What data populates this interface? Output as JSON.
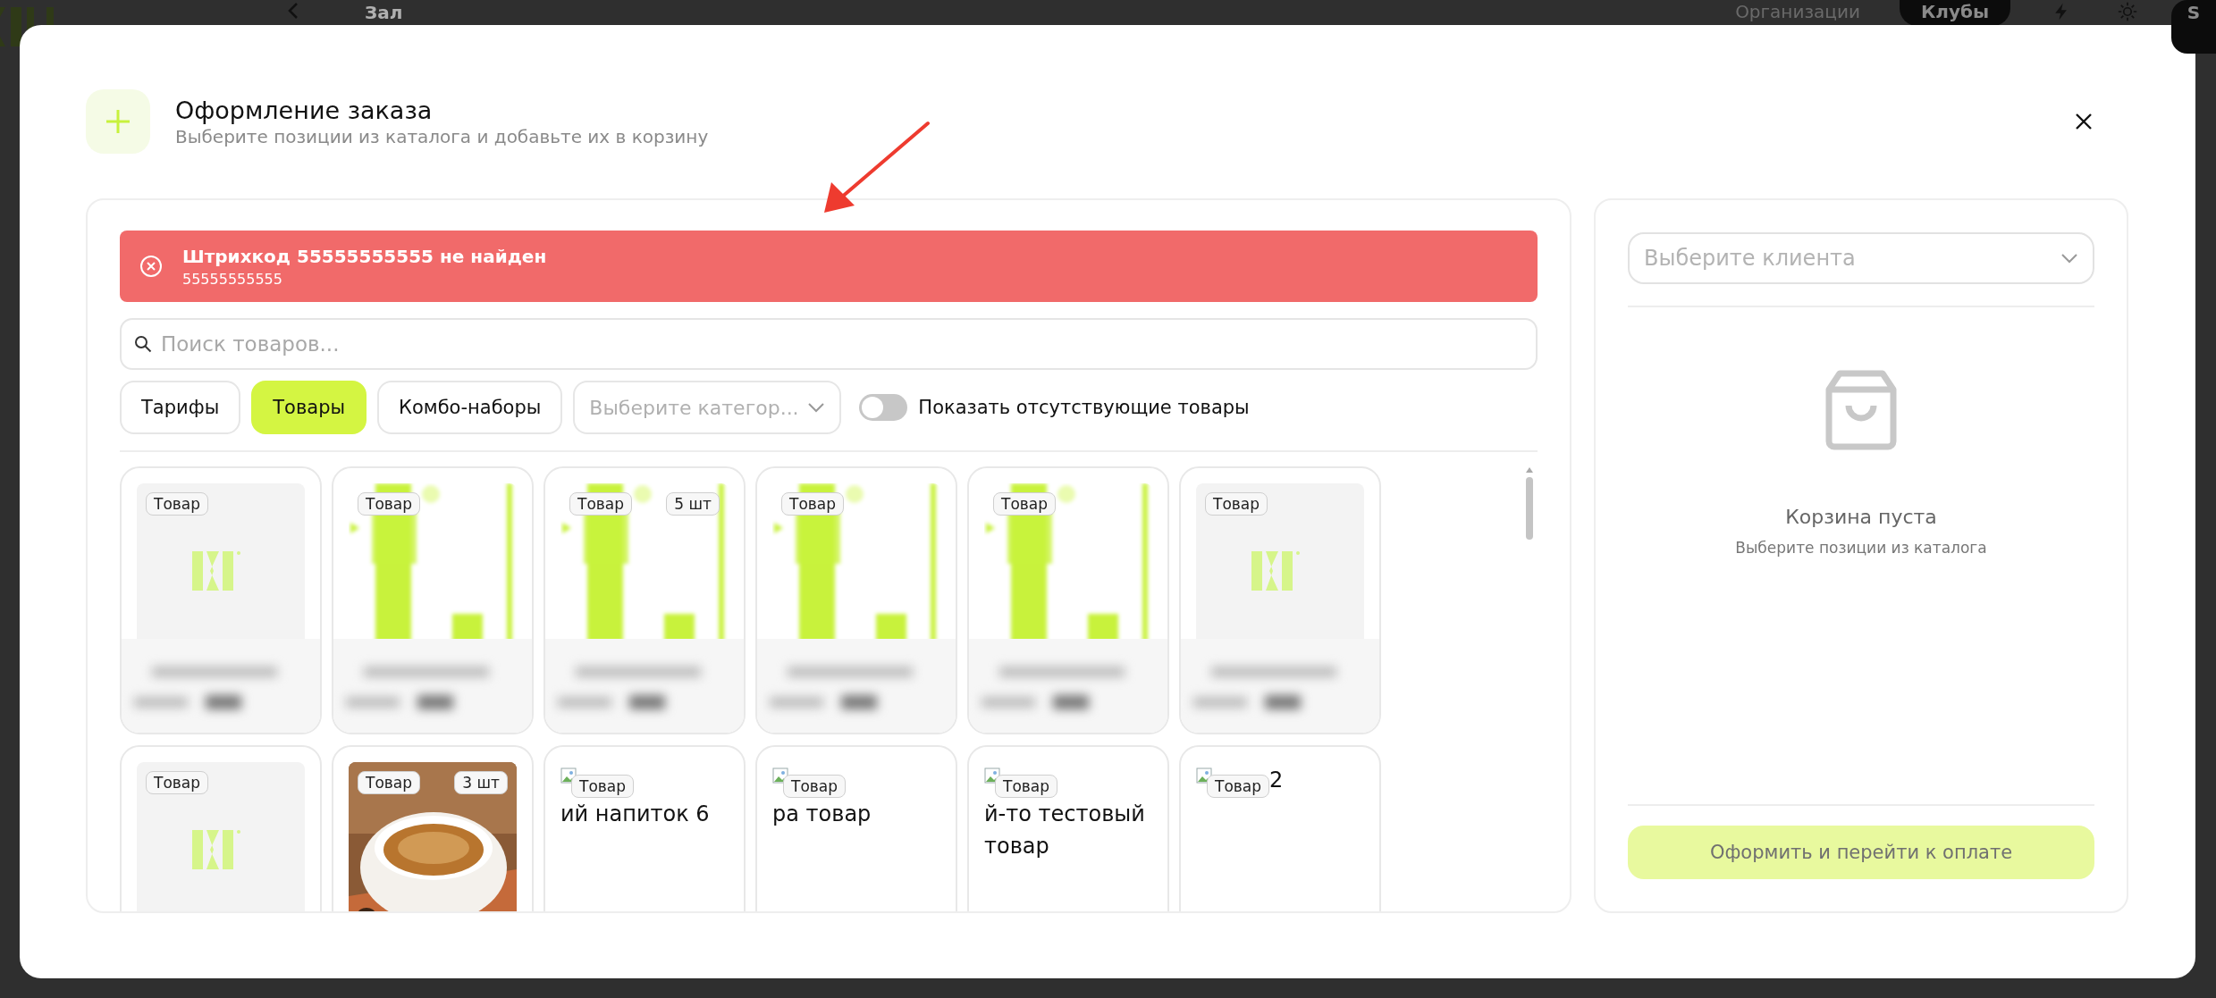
{
  "background": {
    "page_title": "Зал",
    "nav": [
      {
        "label": "Организации",
        "selected": false
      },
      {
        "label": "Клубы",
        "selected": true
      }
    ],
    "avatar": "S"
  },
  "dialog": {
    "title": "Оформление заказа",
    "subtitle": "Выберите позиции из каталога и добавьте их в корзину"
  },
  "alert": {
    "title": "Штрихкод 55555555555 не найден",
    "detail": "55555555555"
  },
  "search": {
    "placeholder": "Поиск товаров..."
  },
  "tabs": [
    {
      "label": "Тарифы",
      "selected": false
    },
    {
      "label": "Товары",
      "selected": true
    },
    {
      "label": "Комбо-наборы",
      "selected": false
    }
  ],
  "category": {
    "placeholder": "Выберите категор..."
  },
  "show_missing": {
    "label": "Показать отсутствующие товары",
    "on": false
  },
  "products": [
    {
      "kind": "logo",
      "badges": [
        "Товар"
      ],
      "blurred": true
    },
    {
      "kind": "bars",
      "badges": [
        "Товар"
      ],
      "blurred": true
    },
    {
      "kind": "bars",
      "badges": [
        "Товар",
        "5 шт"
      ],
      "blurred": true
    },
    {
      "kind": "bars",
      "badges": [
        "Товар"
      ],
      "blurred": true
    },
    {
      "kind": "bars",
      "badges": [
        "Товар"
      ],
      "blurred": true
    },
    {
      "kind": "logo",
      "badges": [
        "Товар"
      ],
      "blurred": true
    },
    {
      "kind": "logo",
      "badges": [
        "Товар"
      ]
    },
    {
      "badges": [
        "Товар",
        "3 шт"
      ]
    },
    {
      "kind": "broken",
      "badges": [
        "Товар"
      ],
      "alt_text": "ий напиток 6"
    },
    {
      "kind": "broken",
      "badges": [
        "Товар"
      ],
      "alt_text": "ра товар"
    },
    {
      "kind": "broken",
      "badges": [
        "Товар"
      ],
      "alt_text": "й-то тестовый товар"
    },
    {
      "kind": "broken",
      "badges": [
        "Товар"
      ],
      "alt_text": "2"
    }
  ],
  "cart": {
    "client_placeholder": "Выберите клиента",
    "empty_title": "Корзина пуста",
    "empty_hint": "Выберите позиции из каталога",
    "checkout": "Оформить и перейти к оплате",
    "checkout_disabled": true
  }
}
